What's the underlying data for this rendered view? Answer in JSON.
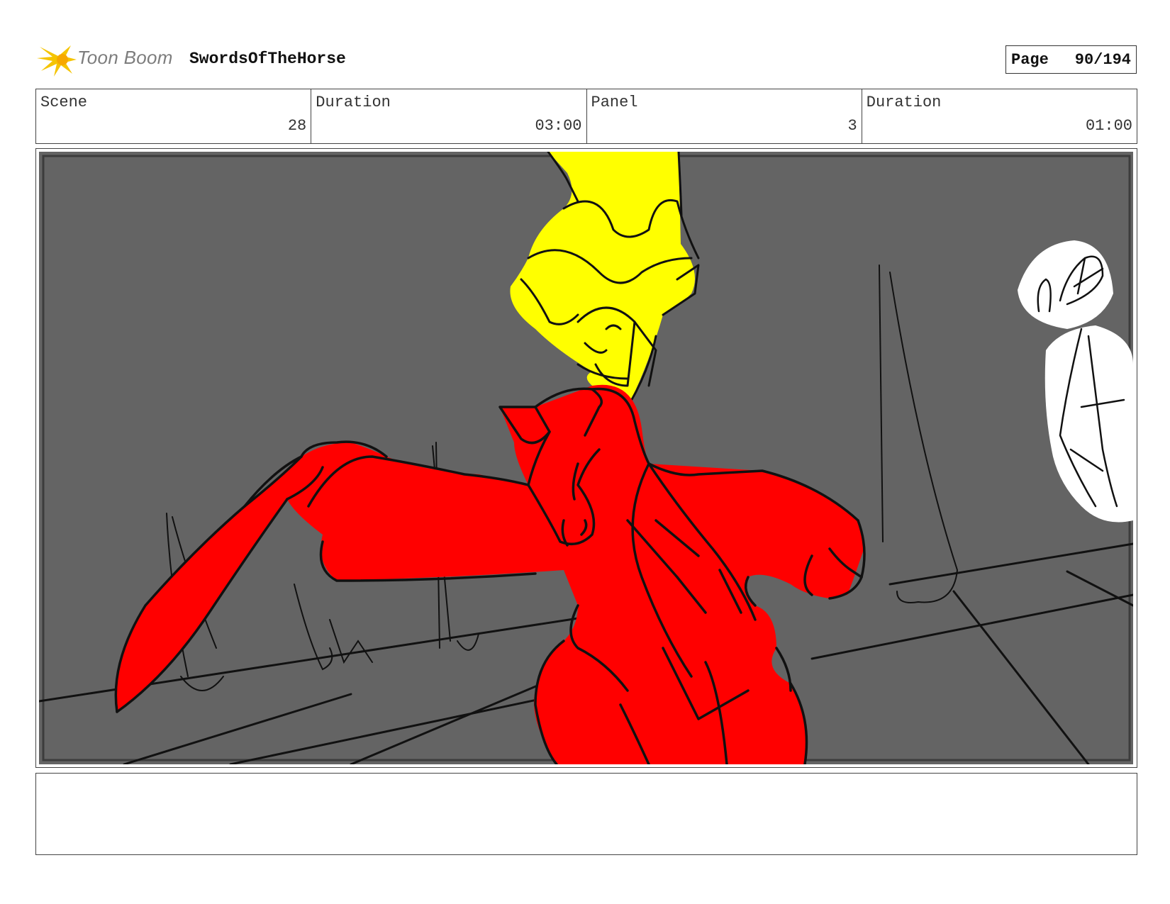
{
  "header": {
    "logo_text": "Toon Boom",
    "project_title": "SwordsOfTheHorse",
    "page_label": "Page",
    "page_number": "90/194"
  },
  "info": {
    "scene_label": "Scene",
    "scene_value": "28",
    "scene_duration_label": "Duration",
    "scene_duration_value": "03:00",
    "panel_label": "Panel",
    "panel_value": "3",
    "panel_duration_label": "Duration",
    "panel_duration_value": "01:00"
  },
  "colors": {
    "background_gray": "#646464",
    "horse_red": "#ff0000",
    "hero_yellow": "#ffff00",
    "line_black": "#111111",
    "logo_yellow": "#f5c400"
  },
  "notes": {
    "text": ""
  }
}
